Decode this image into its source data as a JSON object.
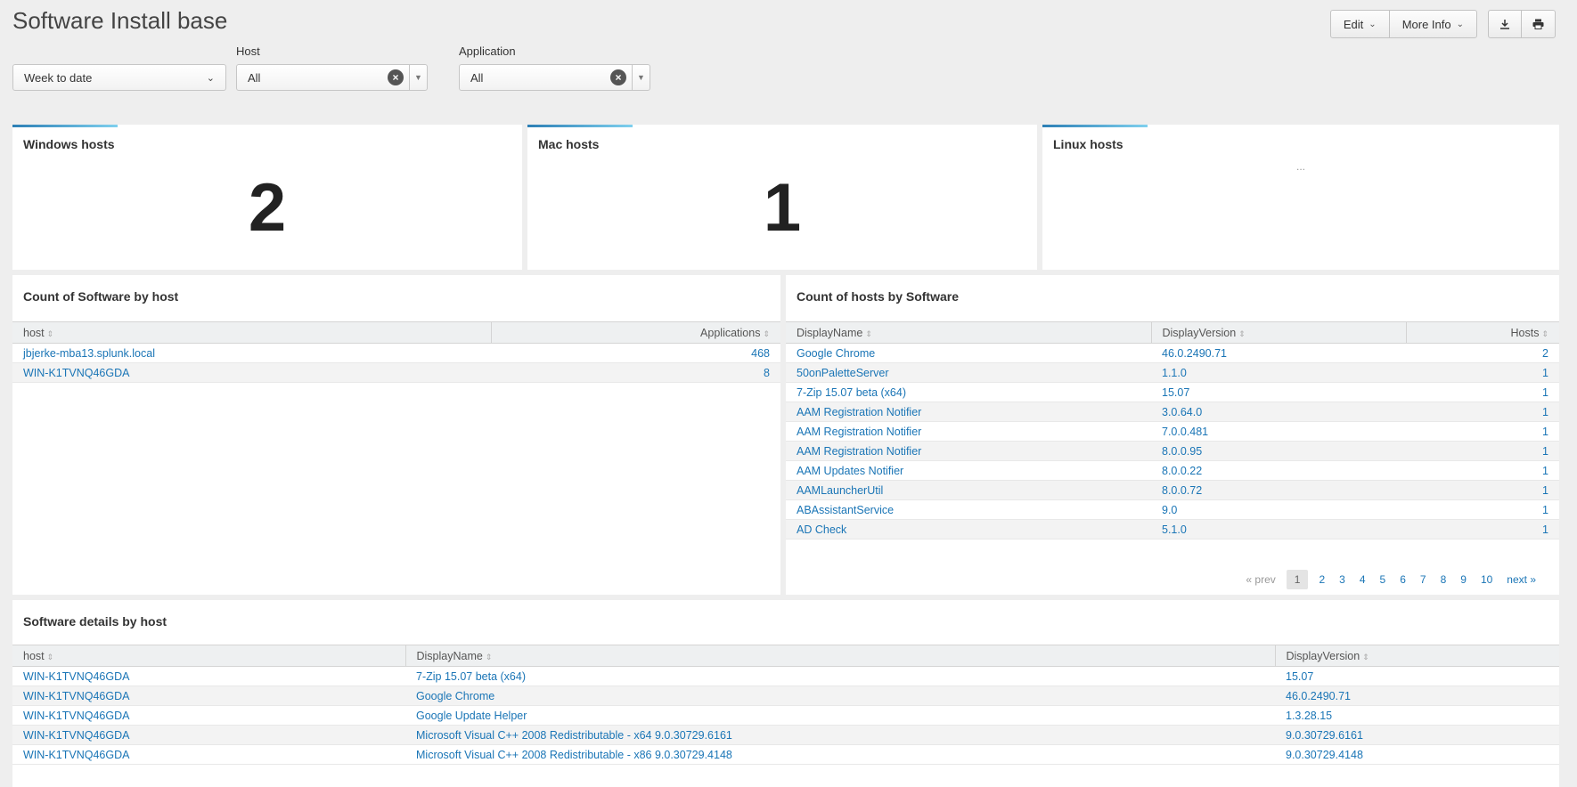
{
  "title": "Software Install base",
  "toolbar": {
    "edit_label": "Edit",
    "more_info_label": "More Info"
  },
  "filters": {
    "time": {
      "value": "Week to date"
    },
    "host": {
      "label": "Host",
      "value": "All"
    },
    "application": {
      "label": "Application",
      "value": "All"
    }
  },
  "singles": {
    "windows": {
      "title": "Windows hosts",
      "value": "2"
    },
    "mac": {
      "title": "Mac hosts",
      "value": "1"
    },
    "linux": {
      "title": "Linux hosts",
      "value": "..."
    }
  },
  "software_by_host": {
    "title": "Count of Software by host",
    "columns": [
      "host",
      "Applications"
    ],
    "rows": [
      [
        "jbjerke-mba13.splunk.local",
        "468"
      ],
      [
        "WIN-K1TVNQ46GDA",
        "8"
      ]
    ]
  },
  "hosts_by_software": {
    "title": "Count of hosts by Software",
    "columns": [
      "DisplayName",
      "DisplayVersion",
      "Hosts"
    ],
    "rows": [
      [
        "Google Chrome",
        "46.0.2490.71",
        "2"
      ],
      [
        "50onPaletteServer",
        "1.1.0",
        "1"
      ],
      [
        "7-Zip 15.07 beta (x64)",
        "15.07",
        "1"
      ],
      [
        "AAM Registration Notifier",
        "3.0.64.0",
        "1"
      ],
      [
        "AAM Registration Notifier",
        "7.0.0.481",
        "1"
      ],
      [
        "AAM Registration Notifier",
        "8.0.0.95",
        "1"
      ],
      [
        "AAM Updates Notifier",
        "8.0.0.22",
        "1"
      ],
      [
        "AAMLauncherUtil",
        "8.0.0.72",
        "1"
      ],
      [
        "ABAssistantService",
        "9.0",
        "1"
      ],
      [
        "AD Check",
        "5.1.0",
        "1"
      ]
    ],
    "pagination": {
      "prev": "« prev",
      "pages": [
        "1",
        "2",
        "3",
        "4",
        "5",
        "6",
        "7",
        "8",
        "9",
        "10"
      ],
      "current": "1",
      "next": "next »"
    }
  },
  "software_details": {
    "title": "Software details by host",
    "columns": [
      "host",
      "DisplayName",
      "DisplayVersion"
    ],
    "rows": [
      [
        "WIN-K1TVNQ46GDA",
        "7-Zip 15.07 beta (x64)",
        "15.07"
      ],
      [
        "WIN-K1TVNQ46GDA",
        "Google Chrome",
        "46.0.2490.71"
      ],
      [
        "WIN-K1TVNQ46GDA",
        "Google Update Helper",
        "1.3.28.15"
      ],
      [
        "WIN-K1TVNQ46GDA",
        "Microsoft Visual C++ 2008 Redistributable - x64 9.0.30729.6161",
        "9.0.30729.6161"
      ],
      [
        "WIN-K1TVNQ46GDA",
        "Microsoft Visual C++ 2008 Redistributable - x86 9.0.30729.4148",
        "9.0.30729.4148"
      ]
    ]
  },
  "icons": {
    "dropdown": "chevron-down-icon",
    "clear": "clear-icon",
    "sort": "sort-icon",
    "export": "download-icon",
    "print": "print-icon"
  }
}
